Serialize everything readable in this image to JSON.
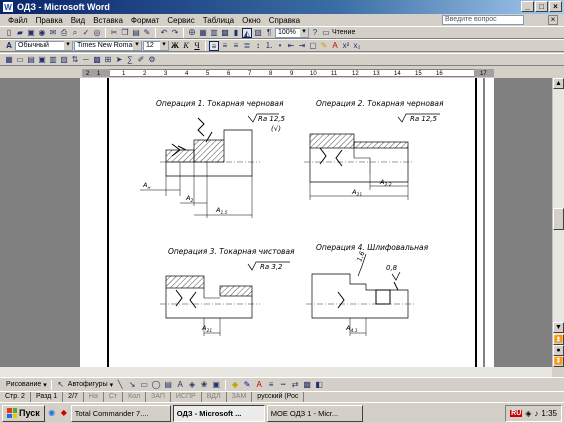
{
  "window": {
    "title": "ОДЗ - Microsoft Word",
    "app_icon": "W"
  },
  "menu": {
    "items": [
      "Файл",
      "Правка",
      "Вид",
      "Вставка",
      "Формат",
      "Сервис",
      "Таблица",
      "Окно",
      "Справка"
    ],
    "help_placeholder": "Введите вопрос"
  },
  "toolbar": {
    "zoom": "100%",
    "reading": "Чтение"
  },
  "formatting": {
    "style": "Обычный",
    "font": "Times New Roman",
    "size": "12",
    "bold": "Ж",
    "italic": "К",
    "underline": "Ч"
  },
  "ruler": {
    "ticks": [
      "2",
      "1",
      "1",
      "2",
      "3",
      "4",
      "5",
      "6",
      "7",
      "8",
      "9",
      "10",
      "11",
      "12",
      "13",
      "14",
      "15",
      "16",
      "17"
    ]
  },
  "drawing": {
    "op1": {
      "title": "Операция 1. Токарная черновая",
      "roughness": "Ra 12,5",
      "roughness_paren": "(√)",
      "dims": [
        "A",
        "A",
        "A"
      ],
      "subs": [
        "н",
        "2",
        "1.5"
      ]
    },
    "op2": {
      "title": "Операция 2. Токарная черновая",
      "roughness": "Ra 12,5",
      "dims": [
        "A",
        "A"
      ],
      "subs": [
        "2.2",
        "21"
      ]
    },
    "op3": {
      "title": "Операция 3. Токарная чистовая",
      "roughness": "Ra 3,2",
      "dims": [
        "A"
      ],
      "subs": [
        "21"
      ]
    },
    "op4": {
      "title": "Операция 4. Шлифовальная",
      "roughness": "1,6",
      "roughness2": "0,8",
      "dims": [
        "A"
      ],
      "subs": [
        "4.1"
      ]
    }
  },
  "drawbar": {
    "draw": "Рисование",
    "autoshapes": "Автофигуры"
  },
  "status": {
    "page": "Стр. 2",
    "section": "Разд 1",
    "pages": "2/7",
    "at": "На",
    "line": "Ст",
    "col": "Кол",
    "rec": "ЗАП",
    "trk": "ИСПР",
    "ext": "ВДЛ",
    "ovr": "ЗАМ",
    "lang": "русский (Рос"
  },
  "taskbar": {
    "start": "Пуск",
    "tasks": [
      "Total Commander 7....",
      "ОДЗ - Microsoft ...",
      "МОЕ ОДЗ 1 - Micr..."
    ],
    "lang": "RU",
    "time": "1:35"
  }
}
